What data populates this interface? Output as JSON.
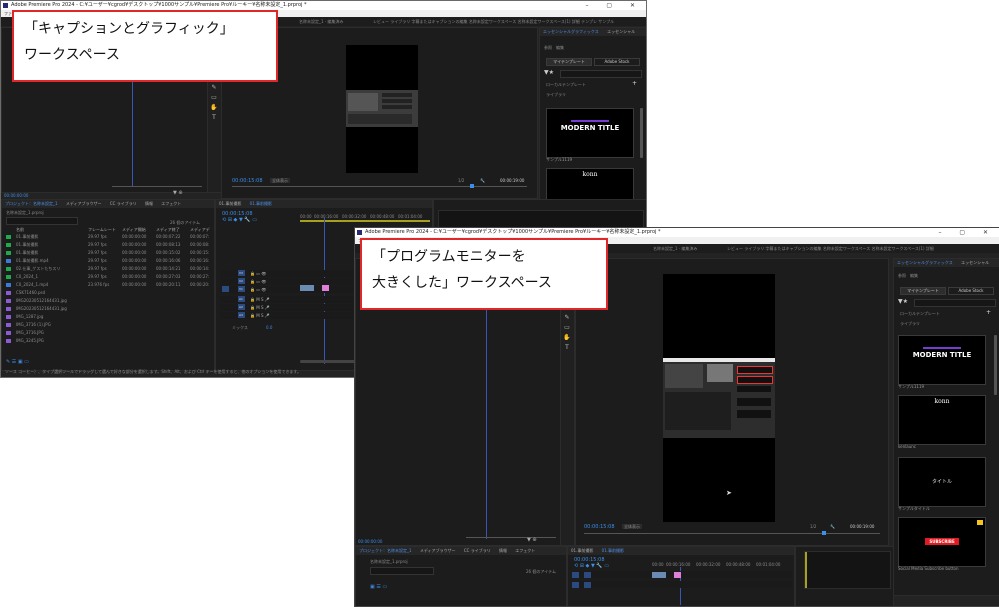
{
  "window1": {
    "title": "Adobe Premiere Pro 2024 - C:¥ユーザー¥cgrod¥デスクトップ¥1000サンプル¥Premiere Pro¥ルーキー¥名称未設定_1.prproj *",
    "menu": "ファイル 編集 クリップ シーケンス マーカー グラフィック 表示 ウィンドウ ヘルプ",
    "workspace_title": "名称未設定_1 · 編集済み",
    "workspace_tabs": "レビュー  ライブラリ  字幕またはキャプションの編集  名称未設定ワークスペース  名称未設定ワークスペース(1)  詳細  テンプレ  サンプル",
    "program_timecode_left": "00:00:15:08",
    "program_fit": "全体表示",
    "program_quality": "1/2",
    "program_timecode_right": "00:00:19:00",
    "eg_tab": "エッセンシャルグラフィックス",
    "eg_tab2": "エッセンシャル",
    "eg_browse": "参照",
    "eg_edit": "編集",
    "eg_my_templates": "マイテンプレート",
    "eg_adobe_stock": "Adobe Stock",
    "eg_local": "ローカルテンプレート",
    "eg_library": "ライブラリ",
    "card_modern": "MODERN TITLE",
    "card_modern_label": "サンプル1119",
    "card_konn": "konn",
    "card_konn_label": "kenlaunc",
    "project_tabs": [
      "プロジェクト：名称未設定_1",
      "メディアブラウザー",
      "CC ライブラリ",
      "情報",
      "エフェクト"
    ],
    "project_name": "名称未設定_1.prproj",
    "items_count": "26 個のアイテム",
    "columns": [
      "名前",
      "フレームレート",
      "メディア開始",
      "メディア終了",
      "メディアデ"
    ],
    "rows": [
      {
        "name": "01.事前撮影",
        "rate": "29.97 fps",
        "start": "00:00:00:00",
        "end": "00:00:07:22",
        "dur": "00:00:07:"
      },
      {
        "name": "01.事前撮影",
        "rate": "29.97 fps",
        "start": "00:00:00:00",
        "end": "00:00:08:13",
        "dur": "00:00:08:"
      },
      {
        "name": "01.事前撮影",
        "rate": "29.97 fps",
        "start": "00:00:00:00",
        "end": "00:00:15:02",
        "dur": "00:00:15:"
      },
      {
        "name": "01.事前撮影.mp4",
        "rate": "29.97 fps",
        "start": "00:00:00:00",
        "end": "00:00:16:06",
        "dur": "00:00:16:"
      },
      {
        "name": "02.仕事_ゲストたちスリ",
        "rate": "29.97 fps",
        "start": "00:00:00:00",
        "end": "00:00:14:21",
        "dur": "00:00:14:"
      },
      {
        "name": "C0_2024_1",
        "rate": "29.97 fps",
        "start": "00:00:00:00",
        "end": "00:00:27:03",
        "dur": "00:00:27:"
      },
      {
        "name": "C0_2024_1.mp4",
        "rate": "23.976 fps",
        "start": "00:00:00:00",
        "end": "00:00:20:11",
        "dur": "00:00:20:"
      },
      {
        "name": "CSK71460.psd",
        "rate": "",
        "start": "",
        "end": "",
        "dur": ""
      },
      {
        "name": "IMG20230512164431.jpg",
        "rate": "",
        "start": "",
        "end": "",
        "dur": ""
      },
      {
        "name": "IMG20230512164431.jpg",
        "rate": "",
        "start": "",
        "end": "",
        "dur": ""
      },
      {
        "name": "IMG_1287.jpg",
        "rate": "",
        "start": "",
        "end": "",
        "dur": ""
      },
      {
        "name": "IMG_3716 (1).JPG",
        "rate": "",
        "start": "",
        "end": "",
        "dur": ""
      },
      {
        "name": "IMG_3716.JPG",
        "rate": "",
        "start": "",
        "end": "",
        "dur": ""
      },
      {
        "name": "IMG_3245.JPG",
        "rate": "",
        "start": "",
        "end": "",
        "dur": ""
      }
    ],
    "timeline_tabs": [
      "01.事前撮影",
      "01.事前撮影"
    ],
    "timeline_timecode": "00:00:15:08",
    "ruler": [
      "00:00",
      "00:00:16:00",
      "00:00:32:00",
      "00:00:48:00",
      "00:01:04:00"
    ],
    "track_labels": [
      "V3",
      "V2",
      "V1",
      "A1",
      "A2",
      "A3"
    ],
    "mix_label": "ミックス",
    "mix_value": "0.0",
    "status": "ソース コーヒー）、タイプ選択ツールでドラッグして選んで好きな部分を選択します。Shift、Alt、および Ctrl キーを使用すると、他のオプションを使用できます。"
  },
  "window2": {
    "title": "Adobe Premiere Pro 2024 - C:¥ユーザー¥cgrod¥デスクトップ¥1000サンプル¥Premiere Pro¥ルーキー¥名称未設定_1.prproj *",
    "menu": "ファイル 編集 クリップ シーケンス マーカー グラフィック 表示 ウィンドウ ヘルプ",
    "workspace_title": "名称未設定_1 · 編集済み",
    "workspace_tabs": "レビュー  ライブラリ  字幕またはキャプションの編集  名称未設定ワークスペース  名称未設定ワークスペース(1)  詳細",
    "program_timecode_left": "00:00:15:08",
    "program_fit": "全体表示",
    "program_quality": "1/2",
    "program_timecode_right": "00:00:19:00",
    "eg_tab": "エッセンシャルグラフィックス",
    "eg_tab2": "エッセンシャル",
    "eg_browse": "参照",
    "eg_edit": "編集",
    "eg_my_templates": "マイテンプレート",
    "eg_adobe_stock": "Adobe Stock",
    "eg_local": "ローカルテンプレート",
    "eg_library": "ライブラリ",
    "card_modern": "MODERN TITLE",
    "card_modern_label": "サンプル1119",
    "card_konn": "konn",
    "card_konn_label": "kenlaunc",
    "card_title": "タイトル",
    "card_title_label": "サンプルタイトル",
    "card_subscribe": "SUBSCRIBE",
    "card_subscribe_label": "Social Media Subscribe button",
    "project_tabs": [
      "プロジェクト：名称未設定_1",
      "メディアブラウザー",
      "CC ライブラリ",
      "情報",
      "エフェクト"
    ],
    "project_name": "名称未設定_1.prproj",
    "items_count": "26 個のアイテム",
    "timeline_tabs": [
      "01.事前撮影",
      "01.事前撮影"
    ],
    "timeline_timecode": "00:00:15:08",
    "ruler": [
      "00:00",
      "00:00:16:00",
      "00:00:32:00",
      "00:00:48:00",
      "00:01:04:00"
    ]
  },
  "callouts": {
    "c1_line1": "「キャプションとグラフィック」",
    "c1_line2": "ワークスペース",
    "c2_line1": "「プログラムモニターを",
    "c2_line2": "大きくした」ワークスペース"
  }
}
